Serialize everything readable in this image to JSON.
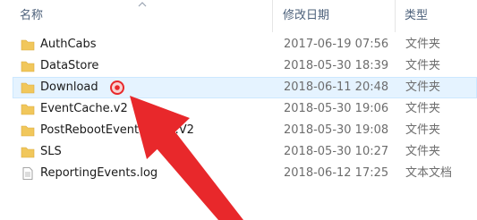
{
  "header": {
    "name": "名称",
    "date": "修改日期",
    "type": "类型"
  },
  "rows": [
    {
      "name": "AuthCabs",
      "date": "2017-06-19 07:56",
      "type": "文件夹",
      "icon": "folder-icon"
    },
    {
      "name": "DataStore",
      "date": "2018-05-30 18:39",
      "type": "文件夹",
      "icon": "folder-icon"
    },
    {
      "name": "Download",
      "date": "2018-06-11 20:48",
      "type": "文件夹",
      "icon": "folder-icon"
    },
    {
      "name": "EventCache.v2",
      "date": "2018-05-30 19:06",
      "type": "文件夹",
      "icon": "folder-icon"
    },
    {
      "name": "PostRebootEventCache.V2",
      "date": "2018-05-30 19:08",
      "type": "文件夹",
      "icon": "folder-icon"
    },
    {
      "name": "SLS",
      "date": "2018-05-30 10:27",
      "type": "文件夹",
      "icon": "folder-icon"
    },
    {
      "name": "ReportingEvents.log",
      "date": "2018-06-12 17:25",
      "type": "文本文档",
      "icon": "text-file-icon"
    }
  ],
  "selected_row": "Download",
  "colors": {
    "folder": "#f1c75b",
    "selection": "#e5f3ff",
    "annotation": "#e8282b"
  }
}
